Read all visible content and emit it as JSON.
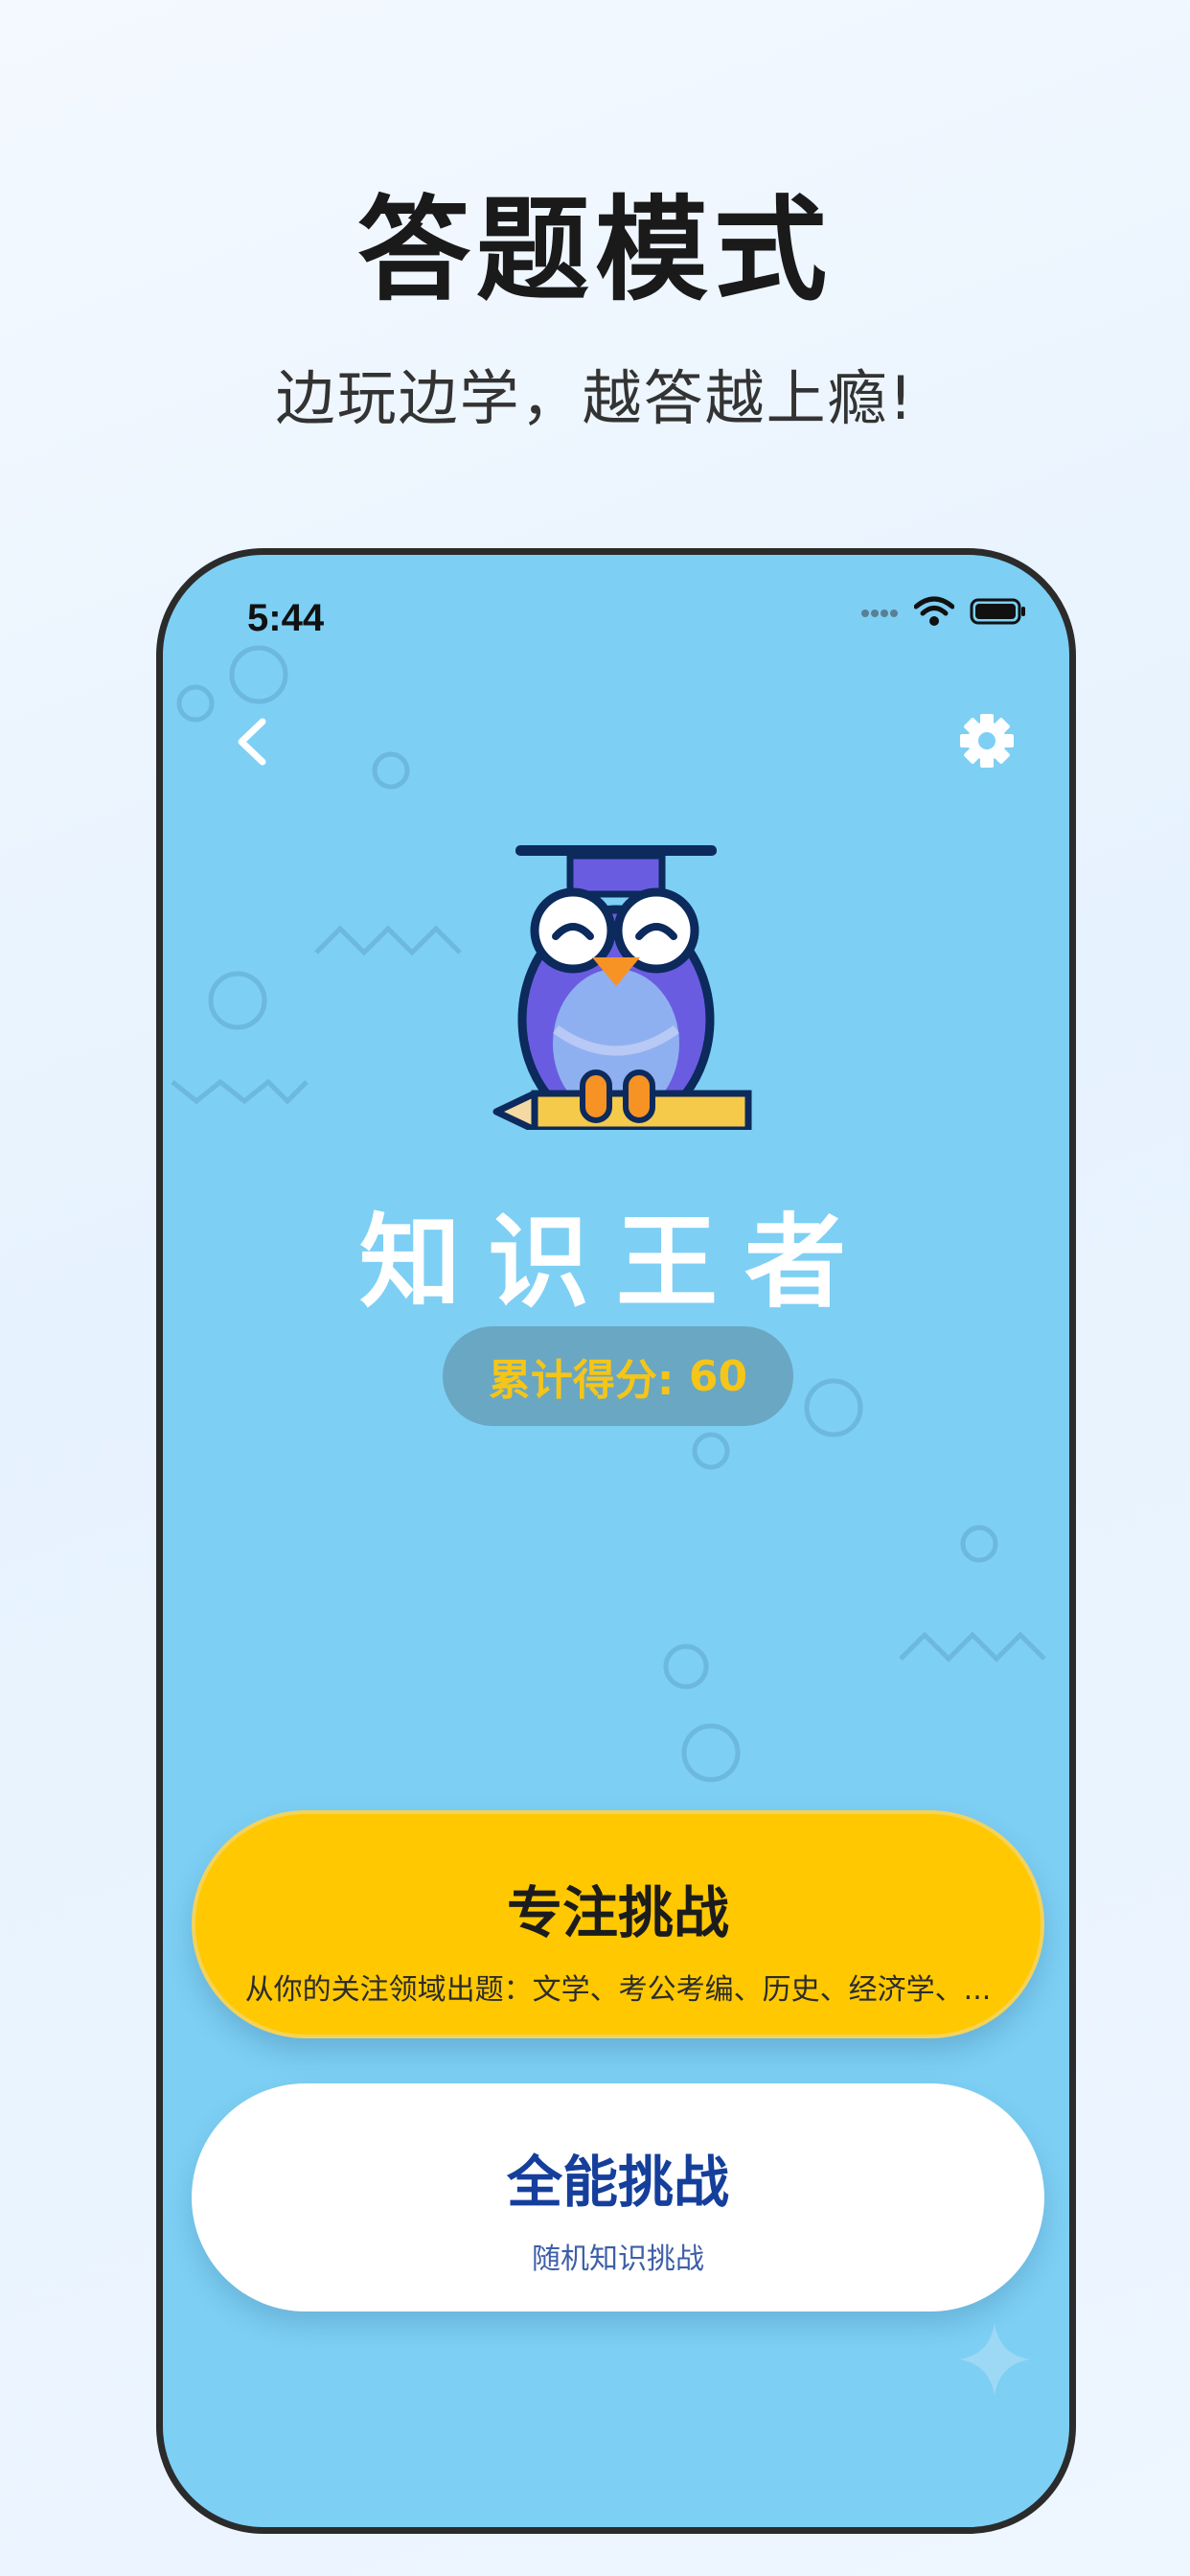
{
  "promo": {
    "headline": "答题模式",
    "subline": "边玩边学，越答越上瘾!"
  },
  "status_bar": {
    "time": "5:44"
  },
  "app": {
    "title": "知识王者",
    "score_label": "累计得分:",
    "score_value": "60",
    "focus_button": {
      "title": "专注挑战",
      "subtitle": "从你的关注领域出题：文学、考公考编、历史、经济学、..."
    },
    "all_button": {
      "title": "全能挑战",
      "subtitle": "随机知识挑战"
    }
  },
  "icons": {
    "back": "chevron-left-icon",
    "settings": "gear-icon",
    "mascot": "owl-graduate-icon"
  },
  "colors": {
    "screen_bg": "#7dcff4",
    "focus_button": "#ffc800",
    "score_text": "#f5c518",
    "all_button_title": "#153f9b"
  }
}
